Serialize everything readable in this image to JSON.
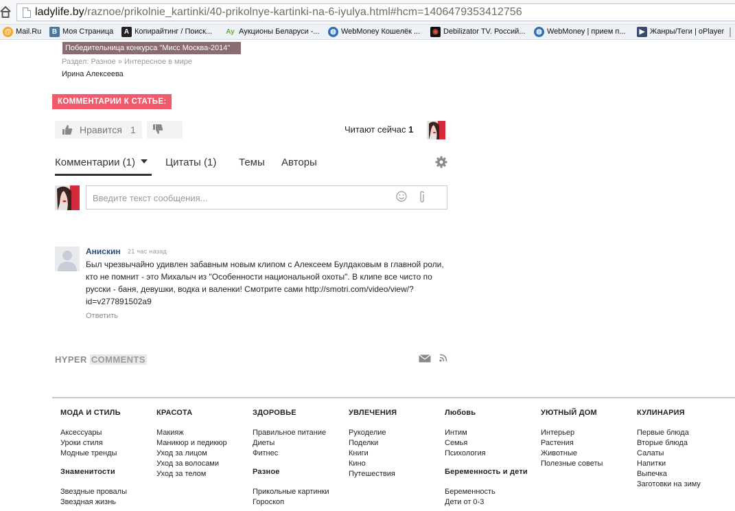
{
  "browser": {
    "url_host": "ladylife.by",
    "url_path": "/raznoe/prikolnie_kartinki/40-prikolnye-kartinki-na-6-iyulya.html#hcm=1406479353412756",
    "bookmarks": [
      {
        "label": "Mail.Ru",
        "icon": "mailru-icon",
        "color": "#f5a623"
      },
      {
        "label": "Моя Страница",
        "icon": "vk-icon",
        "color": "#4c75a3"
      },
      {
        "label": "Копирайтинг / Поиск...",
        "icon": "advego-icon",
        "color": "#222222"
      },
      {
        "label": "Аукционы Беларуси -...",
        "icon": "ay-icon",
        "color": "#6aa84f"
      },
      {
        "label": "WebMoney Кошелёк ...",
        "icon": "webmoney-icon",
        "color": "#2d6fb8"
      },
      {
        "label": "Debilizator TV. Россий...",
        "icon": "debilizator-icon",
        "color": "#c0392b"
      },
      {
        "label": "WebMoney | прием п...",
        "icon": "webmoney-icon",
        "color": "#2d6fb8"
      },
      {
        "label": "Жанры/Теги | oPlayer",
        "icon": "oplayer-icon",
        "color": "#3a4a6b"
      }
    ]
  },
  "article": {
    "caption": "Победительница конкурса \"Мисс Москва-2014\"",
    "section_line": "Раздел: Разное » Интересное в мире",
    "author": "Ирина Алексеева",
    "comments_heading": "КОММЕНТАРИИ К СТАТЬЕ:"
  },
  "widget": {
    "like_label": "Нравится",
    "like_count": "1",
    "reading_now_label": "Читают сейчас",
    "reading_now_count": "1",
    "tabs": [
      {
        "label": "Комментарии (1)",
        "active": true
      },
      {
        "label": "Цитаты (1)",
        "active": false
      },
      {
        "label": "Темы",
        "active": false
      },
      {
        "label": "Авторы",
        "active": false
      }
    ],
    "input_placeholder": "Введите текст сообщения...",
    "comment": {
      "author": "Анискин",
      "time": "21 час назад",
      "text": "Был чрезвычайно удивлен забавным новым клипом с Алексеем Булдаковым в главной роли, кто не помнит - это Михалыч из \"Особенности национальной охоты\". В клипе все чисто по русски - баня, девушки, водка и валенки! Смотрите сами http://smotri.com/video/view/?id=v277891502a9",
      "reply_label": "Ответить"
    },
    "logo_part1": "HYPER",
    "logo_part2": "COMMENTS"
  },
  "footer": {
    "columns": [
      {
        "groups": [
          {
            "heading": "МОДА И СТИЛЬ",
            "items": [
              "Аксессуары",
              "Уроки стиля",
              "Модные тренды"
            ]
          },
          {
            "heading": "Знаменитости",
            "items": [
              "Звездные провалы",
              "Звездная жизнь"
            ]
          }
        ]
      },
      {
        "groups": [
          {
            "heading": "КРАСОТА",
            "items": [
              "Макияж",
              "Маникюр и педикюр",
              "Уход за лицом",
              "Уход за волосами",
              "Уход за телом"
            ]
          }
        ]
      },
      {
        "groups": [
          {
            "heading": "ЗДОРОВЬЕ",
            "items": [
              "Правильное питание",
              "Диеты",
              "Фитнес"
            ]
          },
          {
            "heading": "Разное",
            "items": [
              "Прикольные картинки",
              "Гороскоп"
            ]
          }
        ]
      },
      {
        "groups": [
          {
            "heading": "УВЛЕЧЕНИЯ",
            "items": [
              "Рукоделие",
              "Поделки",
              "Книги",
              "Кино",
              "Путешествия"
            ]
          }
        ]
      },
      {
        "groups": [
          {
            "heading": "Любовь",
            "items": [
              "Интим",
              "Семья",
              "Психология"
            ]
          },
          {
            "heading": "Беременность и дети",
            "items": [
              "Беременность",
              "Дети от 0-3"
            ]
          }
        ]
      },
      {
        "groups": [
          {
            "heading": "УЮТНЫЙ ДОМ",
            "items": [
              "Интерьер",
              "Растения",
              "Животные",
              "Полезные советы"
            ]
          }
        ]
      },
      {
        "groups": [
          {
            "heading": "КУЛИНАРИЯ",
            "items": [
              "Первые блюда",
              "Вторые блюда",
              "Салаты",
              "Напитки",
              "Выпечка",
              "Заготовки на зиму"
            ]
          }
        ]
      }
    ]
  },
  "colors": {
    "accent_pink": "#f2596b",
    "link_blue": "#2a4a75"
  }
}
